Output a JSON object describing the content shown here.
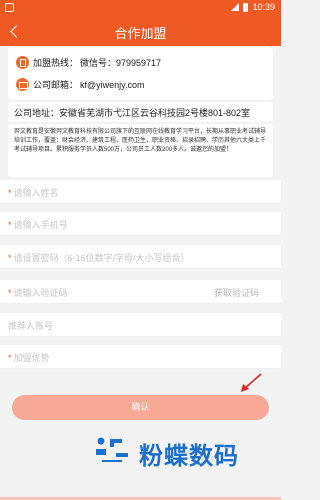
{
  "status_bar": {
    "time": "10:39"
  },
  "nav": {
    "title": "合作加盟"
  },
  "contact": {
    "hotline_label": "加盟热线：",
    "hotline_value": "微信号：979959717",
    "email_label": "公司邮箱：",
    "email_value": "kf@yiwenjy.com"
  },
  "address": "公司地址：安徽省芜湖市弋江区云谷科技园2号楼801-802室",
  "intro": "羿文教育是安徽羿文教育科技有限公司旗下的互联网在线教育学习平台，长期从事职业考试辅导培训工作，覆盖：财会经济、建筑工程、医药卫生、职业资格、招录招聘、学历其他六大类上千考试辅导项目。累积服务学员人数500万，公司员工人数200多人。诚邀您的加盟！",
  "form": {
    "name_placeholder": "请输入姓名",
    "phone_placeholder": "请输入手机号",
    "password_placeholder": "请设置密码（6-16位数字/字母/大小写组合）",
    "code_placeholder": "请输入验证码",
    "get_code_label": "获取验证码",
    "referrer_placeholder": "推荐人账号",
    "advantage_placeholder": "加盟优势",
    "required_mark": "*",
    "confirm_label": "确认"
  },
  "watermark": {
    "text": "粉蝶数码"
  },
  "colors": {
    "brand": "#ef5a24",
    "button": "#f8a897",
    "watermark": "#1d6fce"
  }
}
